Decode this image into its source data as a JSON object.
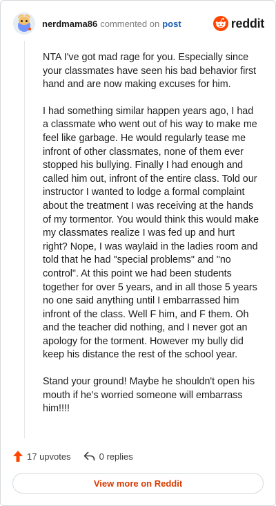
{
  "header": {
    "username": "nerdmama86",
    "action_text": "commented on",
    "post_link": "post",
    "brand_name": "reddit"
  },
  "comment": {
    "paragraphs": [
      "NTA I've got mad rage for you. Especially since your classmates have seen his bad behavior first hand and are now making excuses for him.",
      "I had something similar happen years ago, I had a classmate who went out of his way to make me feel like garbage. He would regularly tease me infront of other classmates, none of them ever stopped his bullying. Finally I had enough and called him out, infront of the entire class. Told our instructor I wanted to lodge a formal complaint about the treatment I was receiving at the hands of my tormentor. You would think this would make my classmates realize I was fed up and hurt right? Nope, I was waylaid in the ladies room and told that he had \"special problems\" and \"no control\". At this point we had been students together for over 5 years, and in all those 5 years no one said anything until I embarrassed him infront of the class. Well F him, and F them. Oh and the teacher did nothing, and I never got an apology for the torment. However my bully did keep his distance the rest of the school year.",
      "Stand your ground! Maybe he shouldn't open his mouth if he's worried someone will embarrass him!!!!"
    ]
  },
  "footer": {
    "upvotes": "17 upvotes",
    "replies": "0 replies",
    "view_more": "View more on Reddit"
  },
  "icons": {
    "avatar": "snoo-avatar",
    "brand": "reddit-logo-icon",
    "upvote": "upvote-arrow-icon",
    "reply": "reply-arrow-icon"
  },
  "colors": {
    "brand_orange": "#ff4500",
    "upvote_orange": "#ff4500",
    "link_blue": "#1a5fb4",
    "view_more_text": "#d93a00"
  }
}
